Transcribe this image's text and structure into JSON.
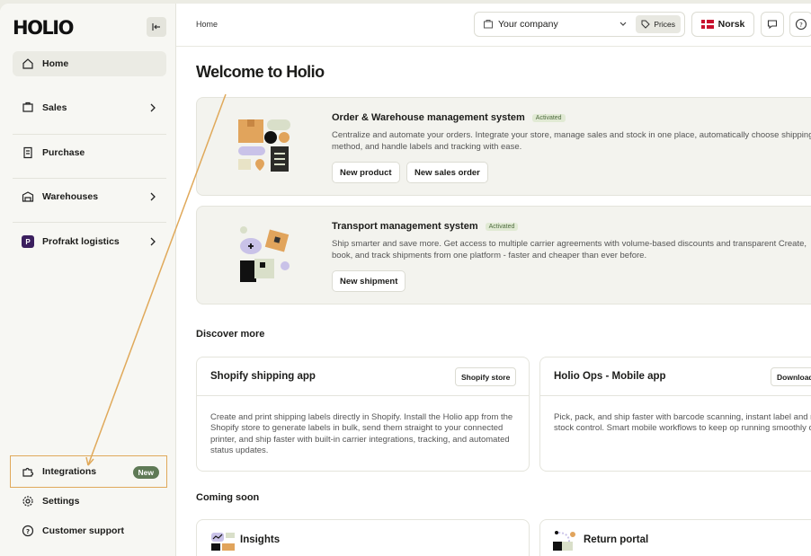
{
  "app": {
    "logo": "HOLIO"
  },
  "sidebar": {
    "items": [
      {
        "label": "Home",
        "has_chevron": false,
        "active": true
      },
      {
        "label": "Sales",
        "has_chevron": true
      },
      {
        "label": "Purchase",
        "has_chevron": false
      },
      {
        "label": "Warehouses",
        "has_chevron": true
      },
      {
        "label": "Profrakt logistics",
        "has_chevron": true
      }
    ],
    "bottom_items": [
      {
        "label": "Integrations",
        "badge": "New"
      },
      {
        "label": "Settings"
      },
      {
        "label": "Customer support"
      }
    ]
  },
  "header": {
    "breadcrumb": "Home",
    "company_select": "Your company",
    "prices_label": "Prices",
    "language": "Norsk"
  },
  "main": {
    "welcome": "Welcome to Holio",
    "systems": [
      {
        "title": "Order & Warehouse management system",
        "status": "Activated",
        "description": "Centralize and automate your orders. Integrate your store, manage sales and stock in one place, automatically choose shipping method, and handle labels and tracking with ease.",
        "buttons": [
          "New product",
          "New sales order"
        ]
      },
      {
        "title": "Transport management system",
        "status": "Activated",
        "description": "Ship smarter and save more. Get access to multiple carrier agreements with volume-based discounts and transparent Create, book, and track shipments from one platform - faster and cheaper than ever before.",
        "buttons": [
          "New shipment"
        ]
      }
    ],
    "discover_title": "Discover more",
    "discover": [
      {
        "title": "Shopify shipping app",
        "button": "Shopify store",
        "description": "Create and print shipping labels directly in Shopify. Install the Holio app from the Shopify store to generate labels in bulk, send them straight to your connected printer, and ship faster with built-in carrier integrations, tracking, and automated status updates."
      },
      {
        "title": "Holio Ops - Mobile app",
        "button": "Download",
        "description": "Pick, pack, and ship faster with barcode scanning, instant label and real-time stock control. Smart mobile workflows to keep op running smoothly on the go."
      }
    ],
    "coming_soon_title": "Coming soon",
    "coming_soon": [
      {
        "title": "Insights"
      },
      {
        "title": "Return portal"
      }
    ]
  },
  "colors": {
    "accent_green": "#5f7a56",
    "highlight_orange": "#e0a95a",
    "activated_bg": "#e1ead4"
  }
}
